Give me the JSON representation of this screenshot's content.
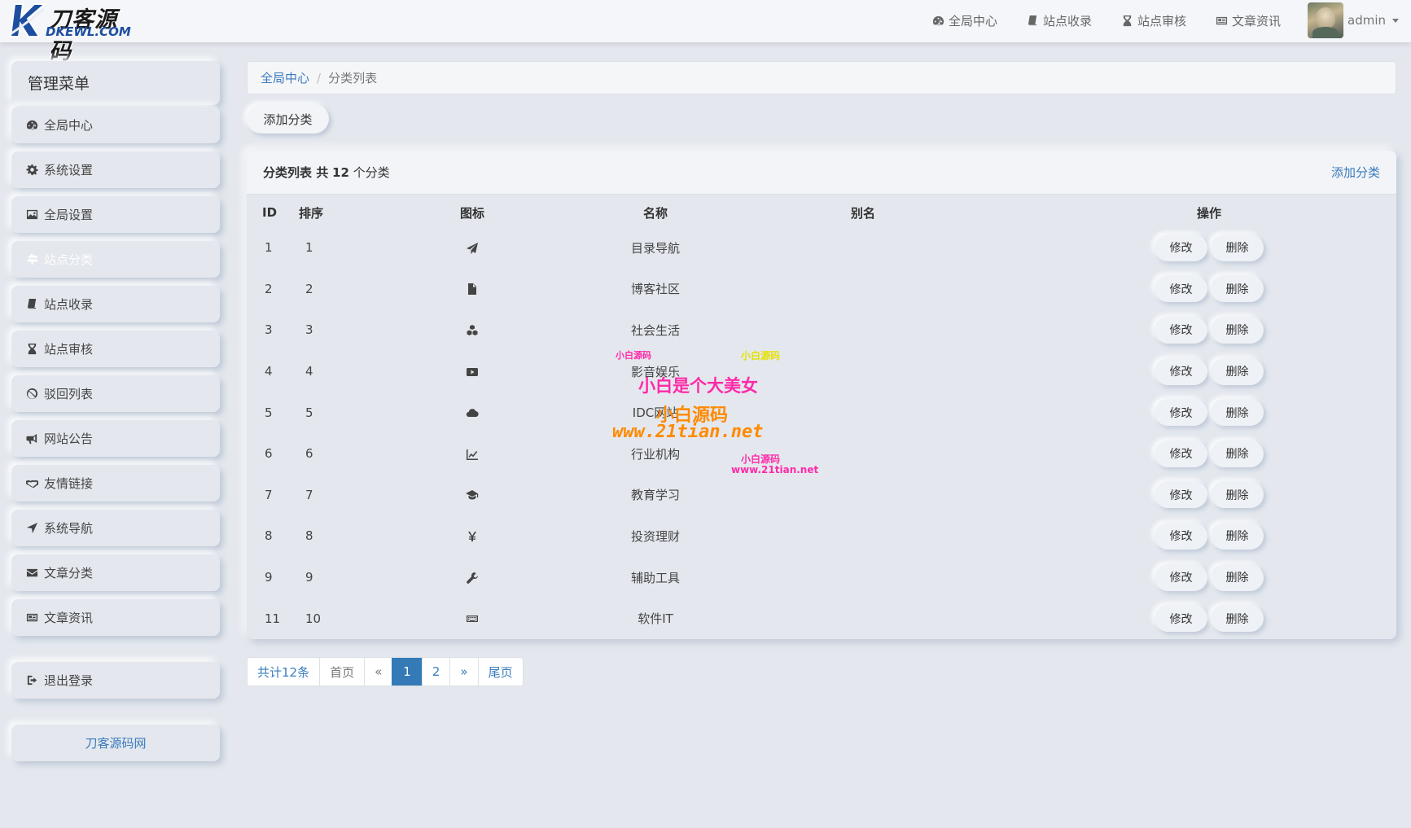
{
  "header": {
    "logo_cn": "刀客源码",
    "logo_en": "DKEWL.COM",
    "nav": [
      {
        "label": "全局中心",
        "icon": "dashboard-icon"
      },
      {
        "label": "站点收录",
        "icon": "book-icon"
      },
      {
        "label": "站点审核",
        "icon": "hourglass-icon"
      },
      {
        "label": "文章资讯",
        "icon": "newspaper-icon"
      }
    ],
    "username": "admin"
  },
  "sidebar": {
    "title": "管理菜单",
    "items": [
      {
        "label": "全局中心",
        "icon": "dashboard-icon"
      },
      {
        "label": "系统设置",
        "icon": "gear-icon"
      },
      {
        "label": "全局设置",
        "icon": "image-icon"
      },
      {
        "label": "站点分类",
        "icon": "signpost-icon",
        "active": true
      },
      {
        "label": "站点收录",
        "icon": "book-icon"
      },
      {
        "label": "站点审核",
        "icon": "hourglass-icon"
      },
      {
        "label": "驳回列表",
        "icon": "ban-icon"
      },
      {
        "label": "网站公告",
        "icon": "bullhorn-icon"
      },
      {
        "label": "友情链接",
        "icon": "handshake-icon"
      },
      {
        "label": "系统导航",
        "icon": "location-arrow-icon"
      },
      {
        "label": "文章分类",
        "icon": "envelope-icon"
      },
      {
        "label": "文章资讯",
        "icon": "newspaper-icon"
      }
    ],
    "logout": "退出登录",
    "site_link": "刀客源码网"
  },
  "breadcrumb": {
    "home": "全局中心",
    "separator": "/",
    "current": "分类列表"
  },
  "toolbar": {
    "add_label": "添加分类"
  },
  "panel": {
    "title_prefix": "分类列表 共",
    "count": "12",
    "title_suffix": "个分类",
    "head_link": "添加分类"
  },
  "table": {
    "headers": {
      "id": "ID",
      "sort": "排序",
      "icon": "图标",
      "name": "名称",
      "alias": "别名",
      "op": "操作"
    },
    "edit_label": "修改",
    "delete_label": "删除",
    "rows": [
      {
        "id": "1",
        "sort": "1",
        "icon": "paper-plane-icon",
        "name": "目录导航",
        "alias": ""
      },
      {
        "id": "2",
        "sort": "2",
        "icon": "file-icon",
        "name": "博客社区",
        "alias": ""
      },
      {
        "id": "3",
        "sort": "3",
        "icon": "cubes-icon",
        "name": "社会生活",
        "alias": ""
      },
      {
        "id": "4",
        "sort": "4",
        "icon": "youtube-icon",
        "name": "影音娱乐",
        "alias": ""
      },
      {
        "id": "5",
        "sort": "5",
        "icon": "cloud-icon",
        "name": "IDC网站",
        "alias": ""
      },
      {
        "id": "6",
        "sort": "6",
        "icon": "line-chart-icon",
        "name": "行业机构",
        "alias": ""
      },
      {
        "id": "7",
        "sort": "7",
        "icon": "graduation-cap-icon",
        "name": "教育学习",
        "alias": ""
      },
      {
        "id": "8",
        "sort": "8",
        "icon": "yen-icon",
        "name": "投资理财",
        "alias": ""
      },
      {
        "id": "9",
        "sort": "9",
        "icon": "wrench-icon",
        "name": "辅助工具",
        "alias": ""
      },
      {
        "id": "11",
        "sort": "10",
        "icon": "keyboard-icon",
        "name": "软件IT",
        "alias": ""
      }
    ]
  },
  "pagination": {
    "total": "共计12条",
    "first": "首页",
    "prev": "«",
    "pages": [
      "1",
      "2"
    ],
    "current": "1",
    "next": "»",
    "last": "尾页"
  },
  "watermark": {
    "line1": "小白源码",
    "line2": "www.21tian.net",
    "line3": "小白是个大美女",
    "line4": "小白源码",
    "line5": "www.21tian.net"
  },
  "colors": {
    "background": "#e4e8ee",
    "accent": "#337ab7",
    "link": "#3a7bbd"
  }
}
